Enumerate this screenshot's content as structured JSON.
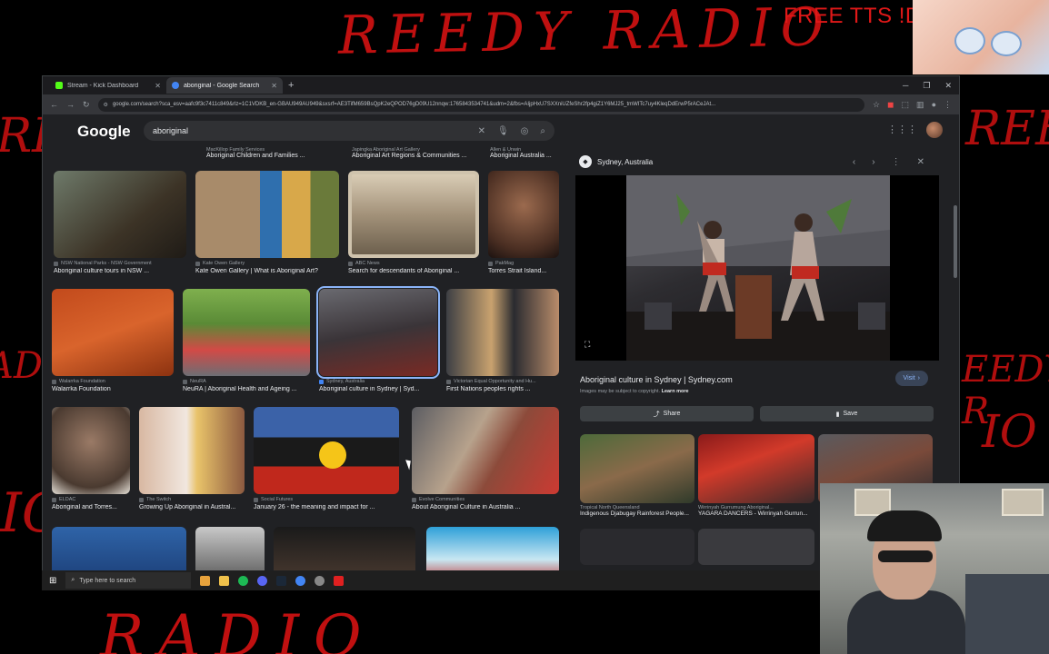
{
  "overlay": {
    "title": "REEDY RADIO",
    "bottom_title": "RADIO",
    "tts_banner": "FREE TTS !DUDE",
    "left_scribble": "REE",
    "right_scribble": "REE",
    "left_mid": "ADI",
    "right_mid": "EEDY R",
    "left_low": "IO",
    "right_low": "IO"
  },
  "browser": {
    "tabs": [
      {
        "label": "Stream - Kick Dashboard",
        "favicon_color": "#53fc18",
        "active": false
      },
      {
        "label": "aboriginal - Google Search",
        "favicon_color": "#4285f4",
        "active": true
      }
    ],
    "url": "google.com/search?sca_esv=aafc9f3c7411c849&rlz=1C1VDKB_en-GBAU949AU949&sxsrf=AE3TifM659BsQpK2eQPOD76gD09U12nnqw:1765843534741&udm=2&fbs=AIjpHxU7SXXniUZfeShr2fp4giZ1Y6MJ25_tmWITc7uy4KleqDdErwP5rACeJAt..."
  },
  "google": {
    "logo": "Google",
    "query": "aboriginal",
    "top_row": [
      {
        "source": "MacKillop Family Services",
        "title": "Aboriginal Children and Families ..."
      },
      {
        "source": "Japingka Aboriginal Art Gallery",
        "title": "Aboriginal Art Regions & Communities ..."
      },
      {
        "source": "Allen & Unwin",
        "title": "Aboriginal Australia ..."
      }
    ],
    "results": [
      {
        "source": "NSW National Parks - NSW Government",
        "title": "Aboriginal culture tours in NSW ..."
      },
      {
        "source": "Kate Owen Gallery",
        "title": "Kate Owen Gallery | What is Aboriginal Art?"
      },
      {
        "source": "ABC News",
        "title": "Search for descendants of Aboriginal ..."
      },
      {
        "source": "PakMag",
        "title": "Torres Strait Island..."
      },
      {
        "source": "Walarrka Foundation",
        "title": "Walarrka Foundation"
      },
      {
        "source": "NeuRA",
        "title": "NeuRA | Aboriginal Health and Ageing ..."
      },
      {
        "source": "Sydney, Australia",
        "title": "Aboriginal culture in Sydney | Syd..."
      },
      {
        "source": "Victorian Equal Opportunity and Hu...",
        "title": "First Nations peoples rights ..."
      },
      {
        "source": "ELDAC",
        "title": "Aboriginal and Torres..."
      },
      {
        "source": "The Switch",
        "title": "Growing Up Aboriginal in Austral..."
      },
      {
        "source": "Social Futures",
        "title": "January 26 - the meaning and impact for ..."
      },
      {
        "source": "Evolve Communities",
        "title": "About Aboriginal Culture in Australia ..."
      }
    ]
  },
  "panel": {
    "site": "Sydney, Australia",
    "title": "Aboriginal culture in Sydney | Sydney.com",
    "note": "Images may be subject to copyright.",
    "learn_more": "Learn more",
    "visit": "Visit",
    "share": "Share",
    "save": "Save",
    "related": [
      {
        "source": "Tropical North Queensland",
        "title": "Indigenous Djabugay Rainforest People..."
      },
      {
        "source": "Wirrinyah Gurrumung Aboriginal...",
        "title": "YAGARA DANCERS - Wirrinyah Gurrun..."
      },
      {
        "source": "",
        "title": ""
      }
    ]
  },
  "taskbar": {
    "search_placeholder": "Type here to search"
  }
}
